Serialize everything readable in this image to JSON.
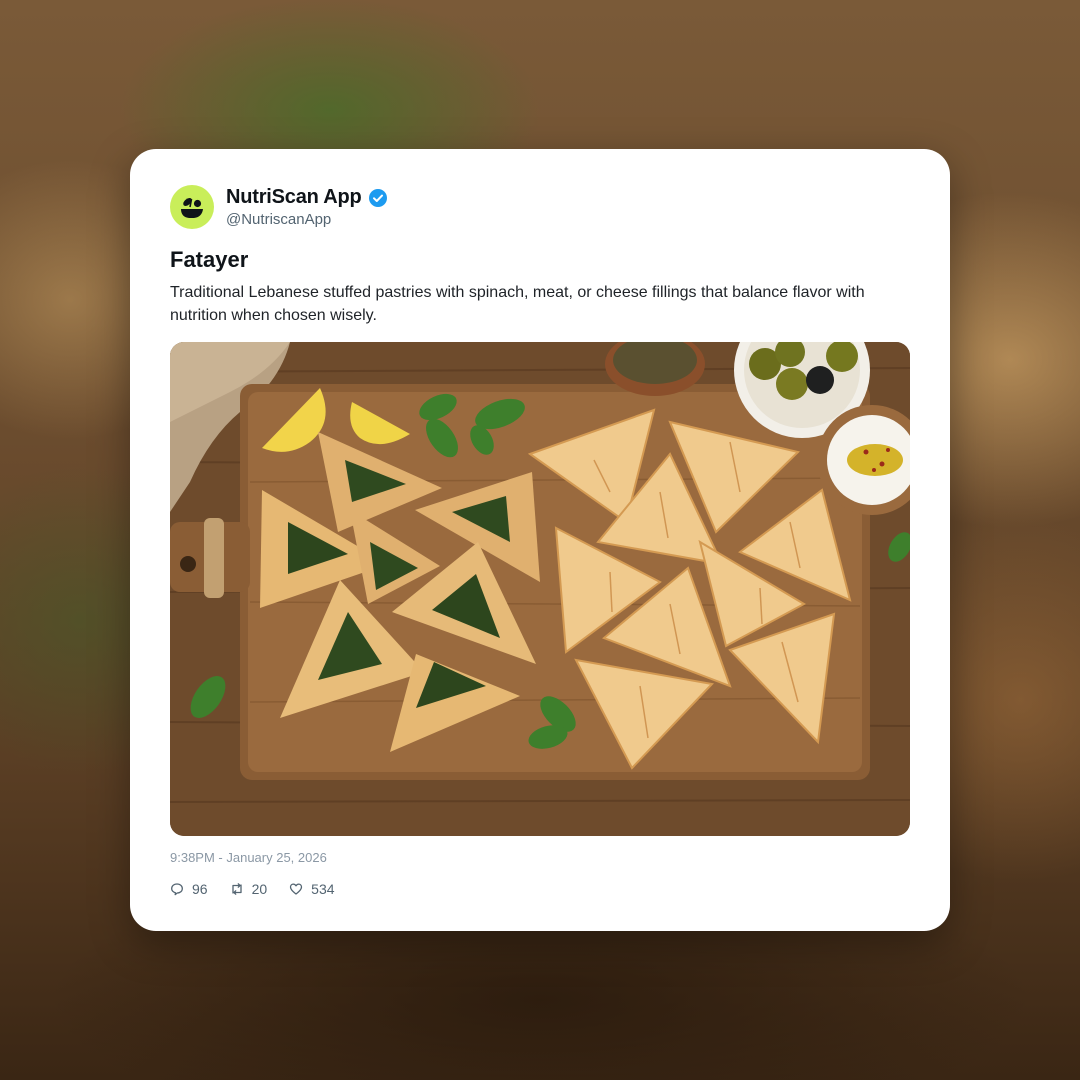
{
  "post": {
    "author_name": "NutriScan App",
    "handle": "@NutriscanApp",
    "verified": true,
    "title": "Fatayer",
    "description": "Traditional Lebanese stuffed pastries with spinach, meat, or cheese fillings that balance flavor with nutrition when chosen wisely.",
    "timestamp": "9:38PM - January 25, 2026",
    "stats": {
      "replies": "96",
      "reposts": "20",
      "likes": "534"
    }
  },
  "icons": {
    "avatar": "nutriscan-logo-icon",
    "verified": "verified-badge-icon",
    "reply": "comment-icon",
    "repost": "repost-icon",
    "like": "heart-icon"
  },
  "colors": {
    "accent": "#1d9bf0",
    "avatar_bg": "#c9ee5a",
    "text_primary": "#0f1419",
    "text_secondary": "#536471"
  }
}
